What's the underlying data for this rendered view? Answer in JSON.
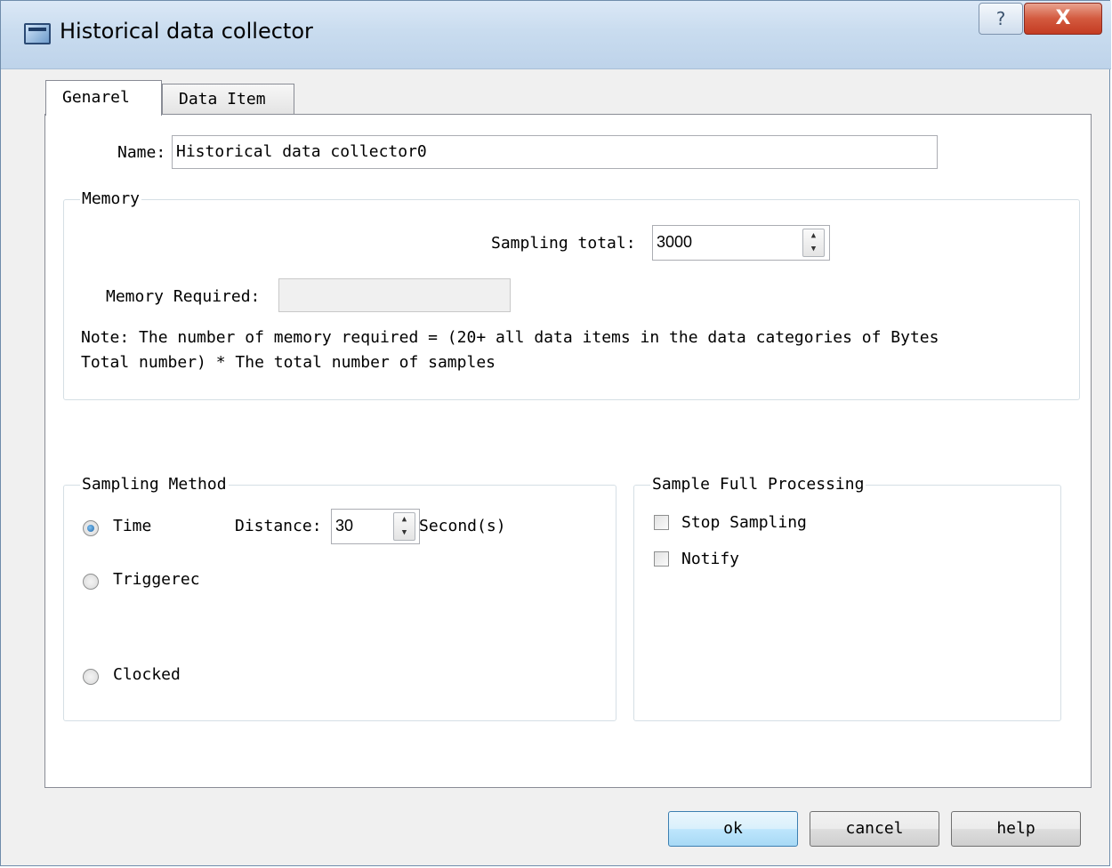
{
  "window": {
    "title": "Historical data collector",
    "help_glyph": "?",
    "close_glyph": "X"
  },
  "tabs": [
    {
      "label": "Genarel",
      "active": true
    },
    {
      "label": "Data Item",
      "active": false
    }
  ],
  "general": {
    "name_label": "Name:",
    "name_value": "Historical data collector0",
    "memory": {
      "legend": "Memory",
      "sampling_total_label": "Sampling total:",
      "sampling_total_value": "3000",
      "memory_required_label": "Memory Required:",
      "memory_required_value": "",
      "note_line1": "Note: The number of memory required = (20+ all data items in the data categories of Bytes",
      "note_line2": "Total number) * The total number of samples"
    },
    "sampling_method": {
      "legend": "Sampling Method",
      "options": [
        {
          "label": "Time",
          "checked": true
        },
        {
          "label": "Triggerec",
          "checked": false
        },
        {
          "label": "Clocked",
          "checked": false
        }
      ],
      "distance_label": "Distance:",
      "distance_value": "30",
      "distance_unit": "Second(s)"
    },
    "sample_full": {
      "legend": "Sample Full Processing",
      "options": [
        {
          "label": "Stop Sampling",
          "checked": false
        },
        {
          "label": "Notify",
          "checked": false
        }
      ]
    }
  },
  "buttons": {
    "ok": "ok",
    "cancel": "cancel",
    "help": "help"
  },
  "colors": {
    "title_gradient": "#c9dcef",
    "close_button": "#c43b22",
    "radio_selected": "#1f66a8",
    "default_button_border": "#3c7fb1"
  }
}
